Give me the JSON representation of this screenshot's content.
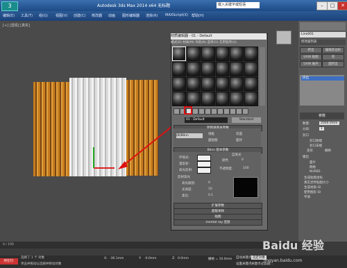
{
  "window": {
    "logo": "3",
    "title": "Autodesk 3ds Max 2014 x64 无标题",
    "search_placeholder": "键入关键字或短语",
    "min": "–",
    "max": "□",
    "close": "✕"
  },
  "menubar": [
    "编辑(E)",
    "工具(T)",
    "组(G)",
    "视图(V)",
    "创建(C)",
    "修改器",
    "动画",
    "图形编辑器",
    "渲染(R)",
    "MAXScript(X)",
    "帮助(H)"
  ],
  "viewport": {
    "label": "[+] [透视] [真实]"
  },
  "material_editor": {
    "title": "材质编辑器 - 01 - Default",
    "menu": "模式(D)  材质(M)  导航(N)  选项(O)  实用程序(U)",
    "material_name": "01 - Default",
    "material_type": "Standard",
    "shader_basic_header": "明暗器基本参数",
    "shader": "(B)Blinn",
    "shader_options": [
      "线框",
      "双面",
      "面贴图",
      "面状"
    ],
    "blinn_header": "Blinn 基本参数",
    "self_illum": "自发光",
    "color_label": "颜色",
    "color_value": "0",
    "ambient": "环境光:",
    "diffuse": "漫反射:",
    "specular": "高光反射:",
    "opacity_label": "不透明度:",
    "opacity_value": "100",
    "specular_highlights": "反射高光",
    "spec_level": "高光级别:",
    "spec_level_value": "0",
    "glossiness": "光泽度:",
    "glossiness_value": "10",
    "soften": "柔化:",
    "soften_value": "0.1",
    "rollouts": [
      "扩展参数",
      "超级采样",
      "贴图",
      "mental ray 连接"
    ]
  },
  "command_panel": {
    "object_name": "Line001",
    "modifier_list": "修改器列表",
    "buttons": [
      "挤出",
      "编辑多边形",
      "UVW 贴图",
      "壳",
      "UVW 展开",
      "面挤出"
    ],
    "stack_item": "挤出",
    "params_header": "参数",
    "amount_label": "数量:",
    "amount_value": "2000.0mm",
    "segments_label": "分段:",
    "segments_value": "1",
    "cap_header": "封口",
    "cap_start": "封口始端",
    "cap_end": "封口末端",
    "morph": "变形",
    "grid": "栅格",
    "output_header": "输出",
    "output_options": [
      "面片",
      "网格",
      "NURBS"
    ],
    "gen_mapping": "生成贴图坐标",
    "real_world": "真实世界贴图大小",
    "gen_mat_ids": "生成材质 ID",
    "use_shape_ids": "使用图形 ID",
    "smooth": "平滑"
  },
  "timeline": {
    "frame": "0 / 100"
  },
  "status": {
    "mode": "所在行:",
    "line1": "选择了 1 个 对象",
    "line2": "单击并拖动以选择并移动对象",
    "x_label": "X:",
    "x_value": "-36.1mm",
    "y_label": "Y:",
    "y_value": "-0.0mm",
    "z_label": "Z:",
    "z_value": "0.0mm",
    "grid": "栅格 = 10.0mm",
    "autokey": "自动关键点",
    "selected": "选定对象",
    "setkey": "设置关键点",
    "keyfilter": "关键点过滤器..."
  },
  "watermark": {
    "logo": "Baidu 经验",
    "sub": "jingyan.baidu.com"
  }
}
